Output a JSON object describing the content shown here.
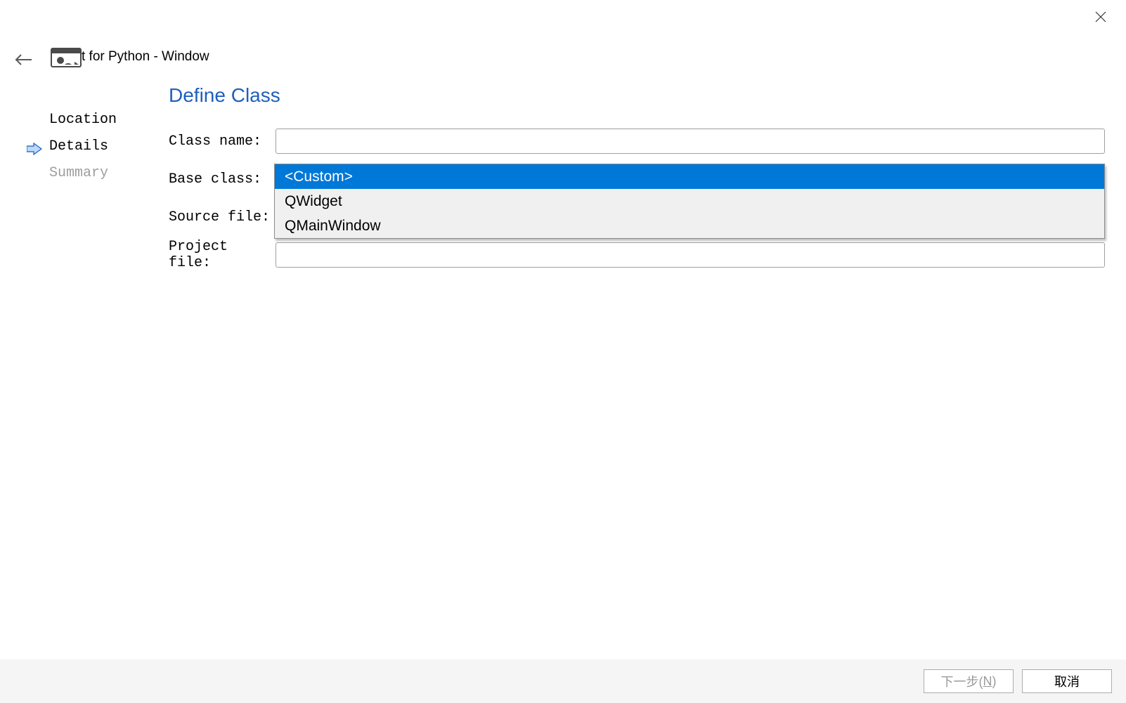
{
  "header": {
    "title": "t for Python - Window"
  },
  "sidebar": {
    "items": [
      {
        "label": "Location",
        "active": false,
        "disabled": false
      },
      {
        "label": "Details",
        "active": true,
        "disabled": false
      },
      {
        "label": "Summary",
        "active": false,
        "disabled": true
      }
    ]
  },
  "main": {
    "title": "Define Class",
    "fields": {
      "class_name": {
        "label": "Class name:",
        "value": ""
      },
      "base_class": {
        "label": "Base class:",
        "value": "<Custom>"
      },
      "source_file": {
        "label": "Source file:",
        "value": ""
      },
      "project_file": {
        "label": "Project file:",
        "value": ""
      }
    },
    "dropdown": {
      "options": [
        "<Custom>",
        "QWidget",
        "QMainWindow"
      ],
      "selected_index": 0
    }
  },
  "footer": {
    "next_label_prefix": "下一步(",
    "next_label_key": "N",
    "next_label_suffix": ")",
    "cancel_label": "取消"
  }
}
